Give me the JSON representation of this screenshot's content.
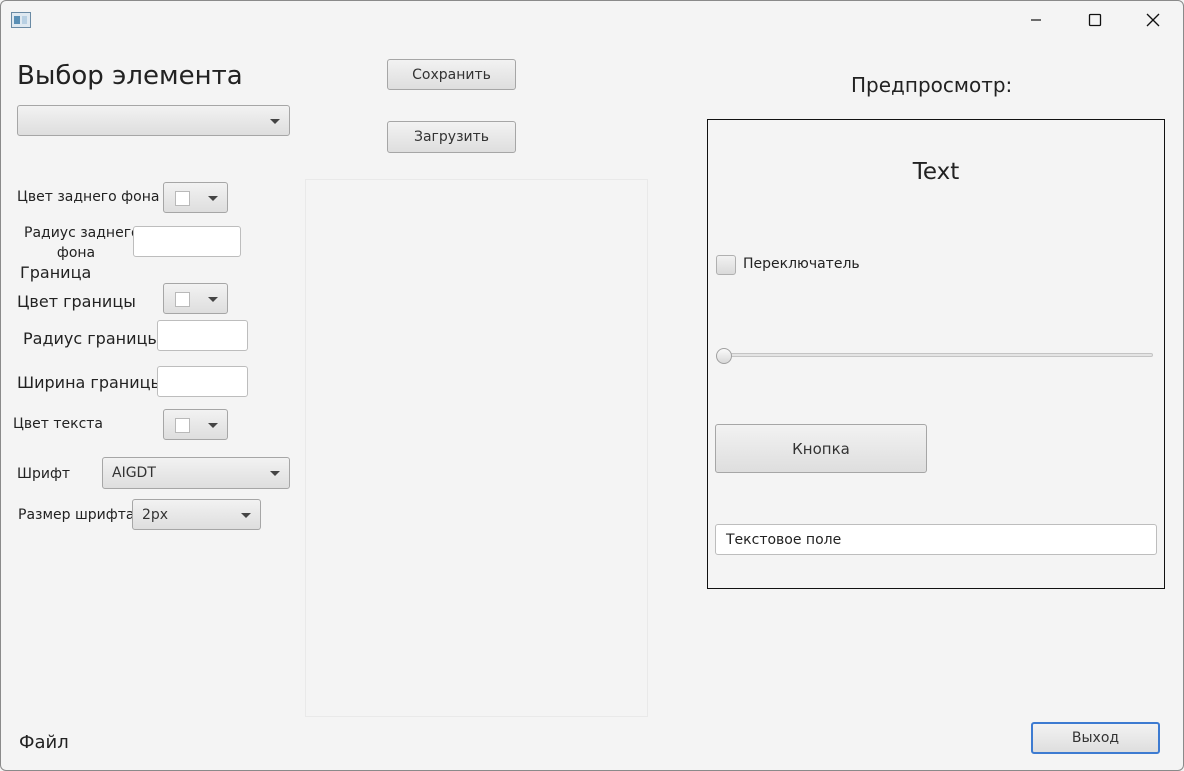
{
  "titlebar": {
    "minimize_icon": "minimize-icon",
    "maximize_icon": "maximize-icon",
    "close_icon": "close-icon"
  },
  "left": {
    "title": "Выбор элемента",
    "element_select_value": "",
    "bg_color_label": "Цвет заднего фона",
    "bg_radius_label_line1": "Радиус заднего",
    "bg_radius_label_line2": "фона",
    "bg_radius_value": "",
    "border_section": "Граница",
    "border_color_label": "Цвет границы",
    "border_radius_label": "Радиус границы",
    "border_radius_value": "",
    "border_width_label": "Ширина границы",
    "border_width_value": "",
    "text_color_label": "Цвет текста",
    "font_label": "Шрифт",
    "font_value": "AIGDT",
    "font_size_label": "Размер шрифта",
    "font_size_value": "2px",
    "file_label": "Файл"
  },
  "middle": {
    "save_label": "Сохранить",
    "load_label": "Загрузить"
  },
  "preview": {
    "title": "Предпросмотр:",
    "text": "Text",
    "checkbox_label": "Переключатель",
    "slider_value": 0,
    "button_label": "Кнопка",
    "textfield_value": "Текстовое поле"
  },
  "footer": {
    "exit_label": "Выход"
  },
  "colors": {
    "background": "#f4f4f4",
    "swatch": "#ffffff",
    "exit_border": "#3d7bd1"
  }
}
